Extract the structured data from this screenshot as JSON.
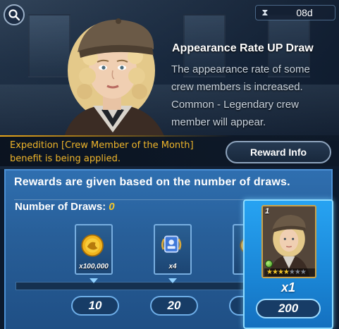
{
  "timer": {
    "icon": "hourglass-icon",
    "value": "08d"
  },
  "banner": {
    "title": "Appearance Rate UP Draw",
    "description": "The appearance rate of some crew members is increased. Common - Legendary crew member will appear."
  },
  "expedition": {
    "text": "Expedition [Crew Member of the Month] benefit is being applied.",
    "color": "#f0b62a"
  },
  "reward_info_button": {
    "label": "Reward Info"
  },
  "rewards_panel": {
    "header": "Rewards are given based on the number of draws.",
    "draws_label": "Number of Draws:",
    "draws_value": "0",
    "milestones": [
      {
        "draws": "10",
        "reward_icon": "gold-coin-icon",
        "quantity": "x100,000"
      },
      {
        "draws": "20",
        "reward_icon": "blue-badge-icon",
        "quantity": "x4"
      },
      {
        "draws": "",
        "reward_icon": "partial-reward-icon",
        "quantity": ""
      }
    ],
    "featured": {
      "draws": "200",
      "card_rank": "1",
      "quantity": "x1",
      "stars_filled": 4,
      "stars_total": 7
    }
  },
  "colors": {
    "accent_gold": "#f4c62a",
    "panel_blue": "#2f6fb0",
    "highlight_blue": "#27a3f2"
  }
}
